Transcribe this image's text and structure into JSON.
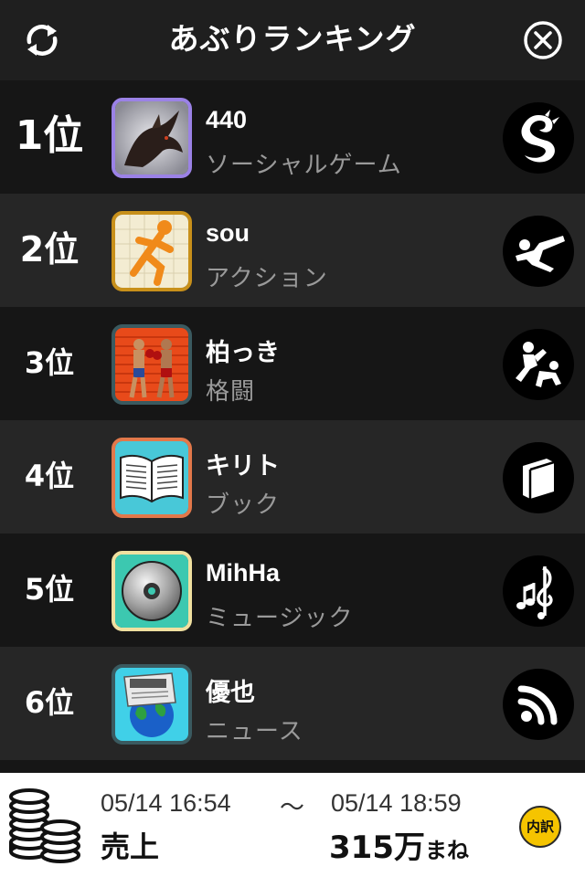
{
  "header": {
    "title": "あぶりランキング",
    "refresh_icon": "refresh-icon",
    "close_icon": "close-circle-icon"
  },
  "rankings": [
    {
      "rank": "1位",
      "name": "440",
      "category": "ソーシャルゲーム",
      "app_icon": "dragon-app-icon",
      "category_icon": "dragon-icon",
      "icon_border": "#9b82e6"
    },
    {
      "rank": "2位",
      "name": "sou",
      "category": "アクション",
      "app_icon": "running-figure-app-icon",
      "category_icon": "kick-icon",
      "icon_border": "#c8901a"
    },
    {
      "rank": "3位",
      "name": "柏っき",
      "category": "格闘",
      "app_icon": "boxing-app-icon",
      "category_icon": "fighting-icon",
      "icon_border": "#3a5a60"
    },
    {
      "rank": "4位",
      "name": "キリト",
      "category": "ブック",
      "app_icon": "open-book-app-icon",
      "category_icon": "book-icon",
      "icon_border": "#e2784a"
    },
    {
      "rank": "5位",
      "name": "MihHa",
      "category": "ミュージック",
      "app_icon": "cd-app-icon",
      "category_icon": "music-notes-icon",
      "icon_border": "#f0e0a0"
    },
    {
      "rank": "6位",
      "name": "優也",
      "category": "ニュース",
      "app_icon": "news-globe-app-icon",
      "category_icon": "rss-icon",
      "icon_border": "#3a5a60"
    }
  ],
  "footer": {
    "from": "05/14 16:54",
    "tilde": "〜",
    "to": "05/14 18:59",
    "label": "売上",
    "amount": "315万",
    "unit": "まね",
    "detail_button": "内訳",
    "coins_icon": "coin-stack-icon",
    "detail_color": "#f5c400"
  }
}
